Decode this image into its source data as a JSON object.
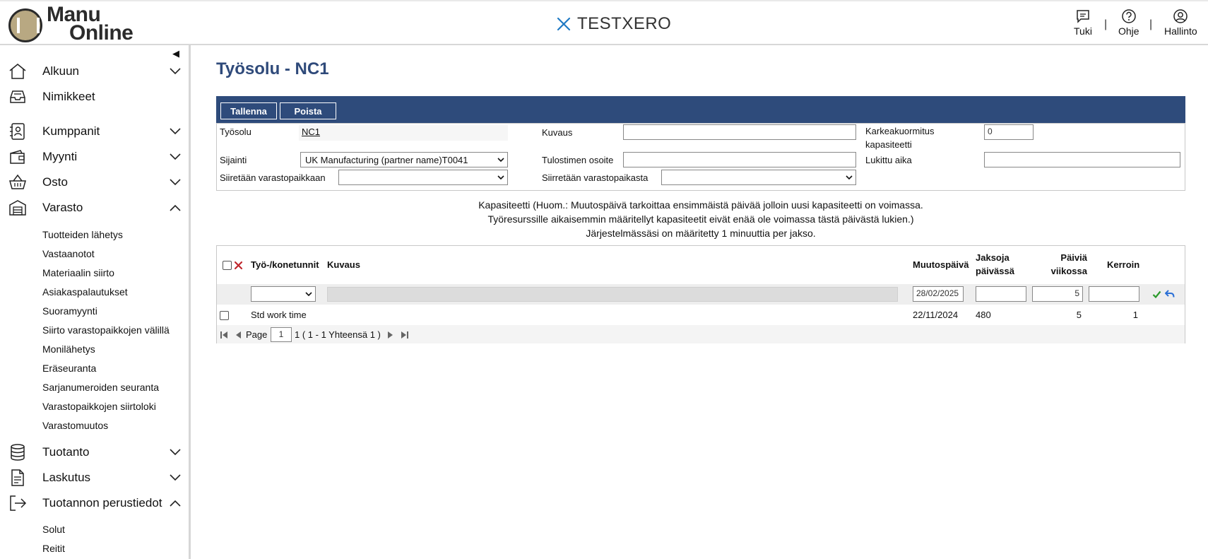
{
  "header": {
    "logo_line1": "Manu",
    "logo_line2": "Online",
    "company": "TESTXERO",
    "tools": [
      {
        "label": "Tuki",
        "icon": "chat-icon"
      },
      {
        "label": "Ohje",
        "icon": "help-icon"
      },
      {
        "label": "Hallinto",
        "icon": "user-icon"
      }
    ],
    "separator": "|"
  },
  "sidebar": {
    "collapse_glyph": "◀",
    "items": [
      {
        "label": "Alkuun",
        "icon": "home-icon",
        "expanded": false
      },
      {
        "label": "Nimikkeet",
        "icon": "inbox-icon"
      },
      {
        "label": "Kumppanit",
        "icon": "contacts-icon",
        "expanded": false
      },
      {
        "label": "Myynti",
        "icon": "wallet-icon",
        "expanded": false
      },
      {
        "label": "Osto",
        "icon": "basket-icon",
        "expanded": false
      },
      {
        "label": "Varasto",
        "icon": "warehouse-icon",
        "expanded": true
      },
      {
        "label": "Tuotanto",
        "icon": "database-icon",
        "expanded": false
      },
      {
        "label": "Laskutus",
        "icon": "document-icon",
        "expanded": false
      },
      {
        "label": "Tuotannon perustiedot",
        "icon": "login-icon",
        "expanded": true
      }
    ],
    "varasto_sub": [
      "Tuotteiden lähetys",
      "Vastaanotot",
      "Materiaalin siirto",
      "Asiakaspalautukset",
      "Suoramyynti",
      "Siirto varastopaikkojen välillä",
      "Monilähetys",
      "Eräseuranta",
      "Sarjanumeroiden seuranta",
      "Varastopaikkojen siirtoloki",
      "Varastomuutos"
    ],
    "perustiedot_sub": [
      "Solut",
      "Reitit"
    ]
  },
  "page": {
    "title": "Työsolu - NC1",
    "buttons": {
      "save": "Tallenna",
      "delete": "Poista"
    }
  },
  "form": {
    "workcell_label": "Työsolu",
    "workcell_value": "NC1",
    "description_label": "Kuvaus",
    "description_value": "",
    "rough_load_label_1": "Karkeakuormitus",
    "rough_load_label_2": "kapasiteetti",
    "rough_load_value": "0",
    "location_label": "Sijainti",
    "location_value": "UK Manufacturing (partner name)T0041",
    "printer_label": "Tulostimen osoite",
    "printer_value": "",
    "locked_label": "Lukittu aika",
    "locked_value": "",
    "move_to_label": "Siiretään varastopaikkaan",
    "move_to_value": "",
    "move_from_label": "Siirretään varastopaikasta",
    "move_from_value": ""
  },
  "note": {
    "line1": "Kapasiteetti (Huom.: Muutospäivä tarkoittaa ensimmäistä päivää jolloin uusi kapasiteetti on voimassa.",
    "line2": "Työresurssille aikaisemmin määritellyt kapasiteetit eivät enää ole voimassa tästä päivästä lukien.)",
    "line3": "Järjestelmässäsi on määritetty 1 minuuttia per jakso."
  },
  "capacity": {
    "headers": {
      "unit": "Työ-/konetunnit",
      "description": "Kuvaus",
      "change_date": "Muutospäivä",
      "periods_1": "Jaksoja",
      "periods_2": "päivässä",
      "days_1": "Päiviä",
      "days_2": "viikossa",
      "factor": "Kerroin"
    },
    "filter": {
      "unit": "",
      "date": "28/02/2025",
      "periods": "",
      "days": "5",
      "factor": ""
    },
    "rows": [
      {
        "unit": "Std work time",
        "date": "22/11/2024",
        "periods": "480",
        "days": "5",
        "factor": "1"
      }
    ],
    "pager": {
      "page_label": "Page",
      "page": "1",
      "summary": "1 ( 1 - 1 Yhteensä 1 )"
    }
  },
  "colors": {
    "accent": "#2e4b7b",
    "title": "#2f4a7a",
    "confirm": "#2a9a2a",
    "undo": "#2a6fd6",
    "delete": "#c0272d"
  }
}
